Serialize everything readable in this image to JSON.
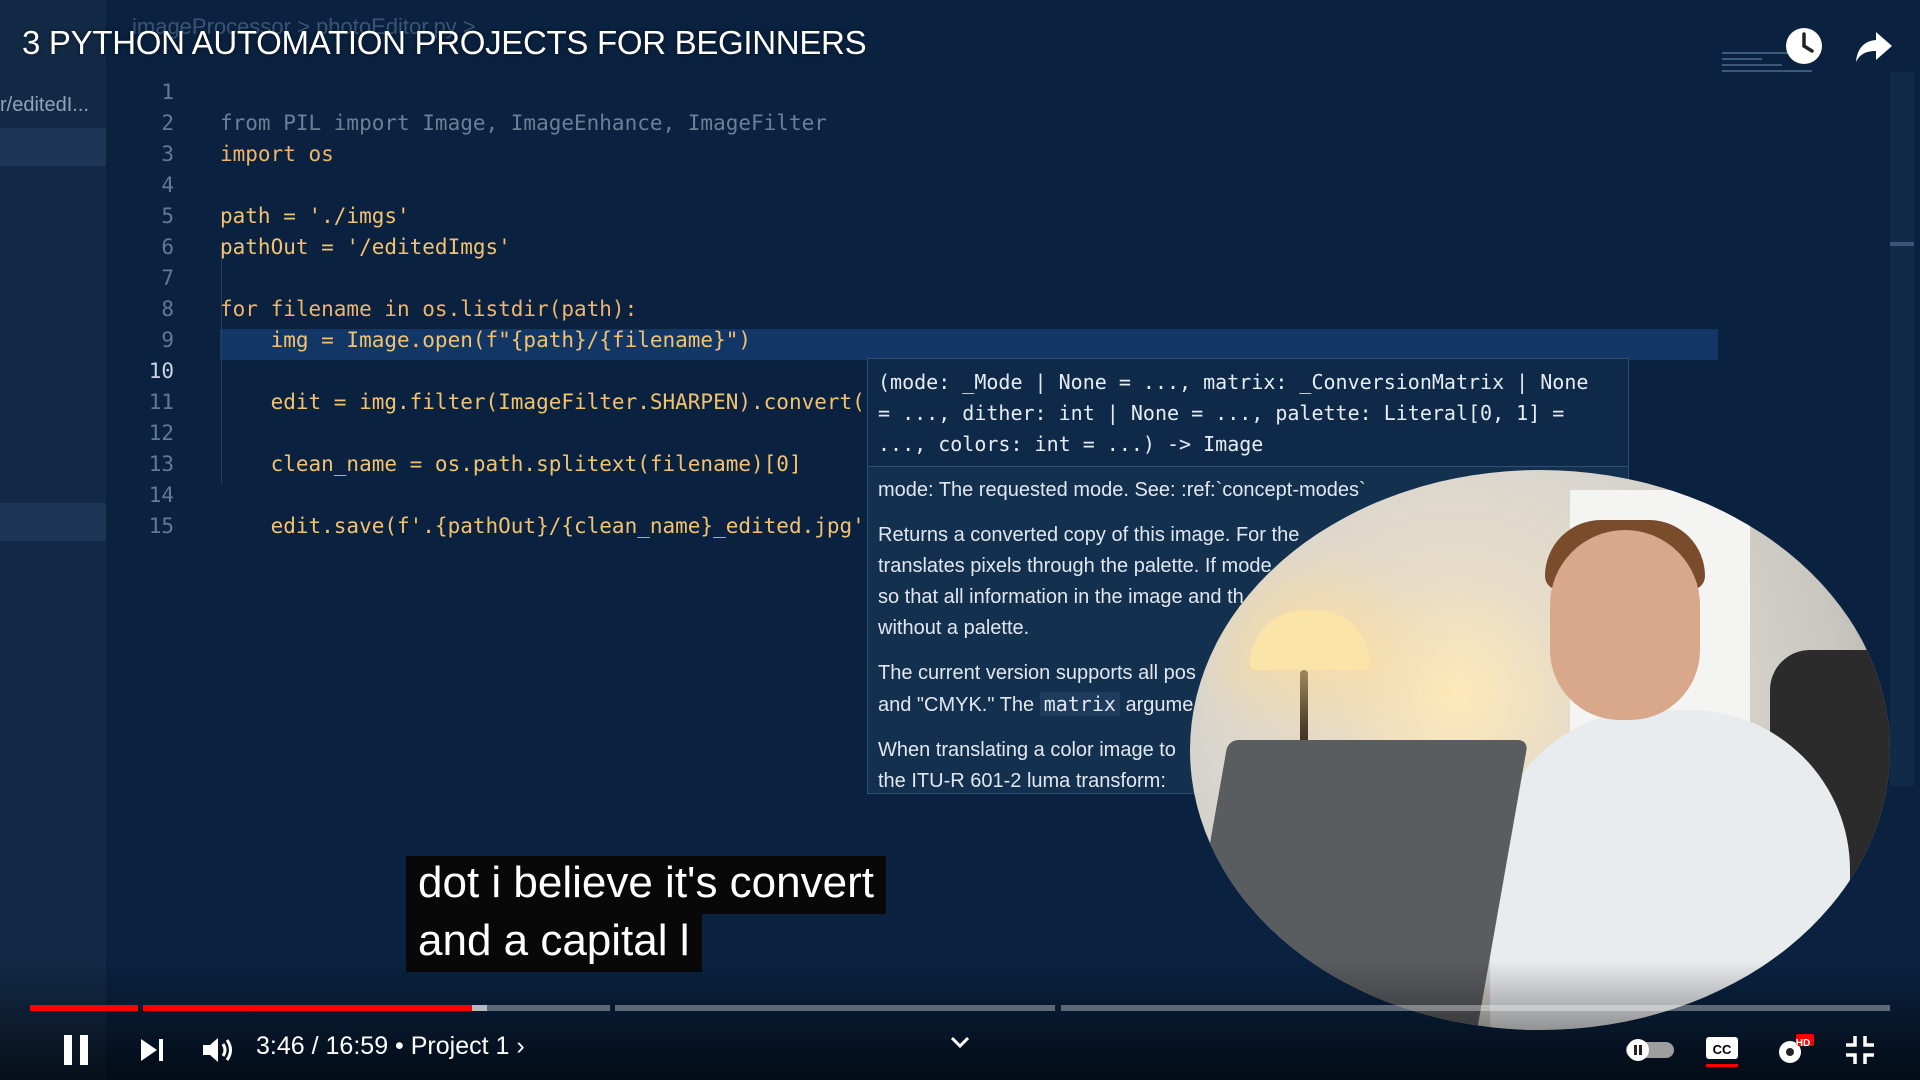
{
  "video": {
    "title": "3 PYTHON AUTOMATION PROJECTS FOR BEGINNERS",
    "time_current": "3:46",
    "time_total": "16:59",
    "chapter": "Project 1",
    "progress_played_fraction": 0.2,
    "captions": [
      "dot i believe it's convert",
      "and a capital l"
    ]
  },
  "editor": {
    "breadcrumb": "imageProcessor  >  photoEditor.py  >",
    "sidebar_file": "r/editedI...",
    "lines": [
      {
        "n": "1",
        "text": "from PIL import Image, ImageEnhance, ImageFilter"
      },
      {
        "n": "2",
        "text": "import os"
      },
      {
        "n": "3",
        "text": ""
      },
      {
        "n": "4",
        "text": "path = './imgs'"
      },
      {
        "n": "5",
        "text": "pathOut = '/editedImgs'"
      },
      {
        "n": "6",
        "text": ""
      },
      {
        "n": "7",
        "text": "for filename in os.listdir(path):"
      },
      {
        "n": "8",
        "text": "    img = Image.open(f\"{path}/{filename}\")"
      },
      {
        "n": "9",
        "text": ""
      },
      {
        "n": "10",
        "text": "    edit = img.filter(ImageFilter.SHARPEN).convert('')"
      },
      {
        "n": "11",
        "text": ""
      },
      {
        "n": "12",
        "text": "    clean_name = os.path.splitext(filename)[0]"
      },
      {
        "n": "13",
        "text": ""
      },
      {
        "n": "14",
        "text": "    edit.save(f'.{pathOut}/{clean_name}_edited.jpg')"
      },
      {
        "n": "15",
        "text": ""
      }
    ]
  },
  "popup": {
    "signature_line1": "(mode: _Mode | None = ..., matrix: _ConversionMatrix | None",
    "signature_line2": "= ..., dither: int | None = ..., palette: Literal[0, 1] =",
    "signature_line3": "..., colors: int = ...) -> Image",
    "doc_mode": "mode: The requested mode. See: :ref:`concept-modes`",
    "doc_p1_l1": "Returns a converted copy of this image. For the",
    "doc_p1_l2": "translates pixels through the palette. If mode",
    "doc_p1_l3": "so that all information in the image and th",
    "doc_p1_l4": "without a palette.",
    "doc_p2_l1": "The current version supports all pos",
    "doc_p2_l2_a": "and \"CMYK.\" The",
    "doc_p2_l2_code": "matrix",
    "doc_p2_l2_b": "argume",
    "doc_p3_l1": "When translating a color image to",
    "doc_p3_l2": "the ITU-R 601-2 luma transform:"
  },
  "icons": {
    "clock": "clock-icon",
    "share": "share-icon",
    "pause": "pause-icon",
    "next": "next-icon",
    "volume": "volume-icon",
    "autoplay": "autoplay-toggle-icon",
    "cc": "cc-icon",
    "settings": "settings-gear-icon",
    "exit_fullscreen": "exit-fullscreen-icon"
  },
  "colors": {
    "accent_red": "#ff0000",
    "editor_bg": "#0a2240"
  },
  "badges": {
    "settings_badge": "HD"
  }
}
